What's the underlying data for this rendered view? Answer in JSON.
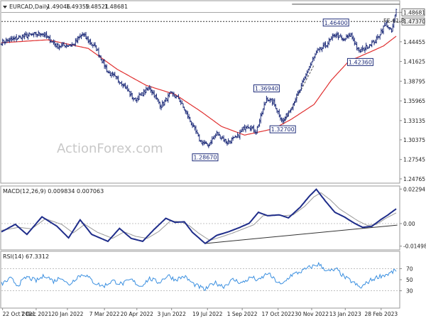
{
  "chart_data": [
    {
      "type": "line",
      "title": "EURCAD,Daily",
      "ohlc": {
        "open": "1.49046",
        "high": "1.49359",
        "low": "1.48521",
        "close": "1.48681"
      },
      "ylim": [
        1.2425,
        1.5025
      ],
      "y_ticks": [
        "1.48681",
        "1.47370",
        "1.44455",
        "1.41625",
        "1.38795",
        "1.35965",
        "1.33135",
        "1.30375",
        "1.27545",
        "1.24765"
      ],
      "y_tick_values": [
        1.48681,
        1.4737,
        1.44455,
        1.41625,
        1.38795,
        1.35965,
        1.33135,
        1.30375,
        1.27545,
        1.24765
      ],
      "highlighted_ticks": [
        "1.48681",
        "1.47370"
      ],
      "annotations": [
        {
          "label": "1.28670",
          "date_index": 176,
          "price": 1.2867
        },
        {
          "label": "1.36940",
          "date_index": 229,
          "price": 1.3694
        },
        {
          "label": "1.32700",
          "date_index": 243,
          "price": 1.327
        },
        {
          "label": "1.46400",
          "date_index": 289,
          "price": 1.464
        },
        {
          "label": "1.42360",
          "date_index": 310,
          "price": 1.4236
        }
      ],
      "fib_label": "FE 61.8",
      "fib_price": 1.4985,
      "resistance_price": 1.4737,
      "trendline": [
        {
          "date_index": 242,
          "price": 1.3215
        },
        {
          "date_index": 270,
          "price": 1.411
        }
      ],
      "watermark": "ActionForex.com",
      "series": [
        {
          "type": "ohlc",
          "color": "#1f2d7a",
          "anchors": [
            [
              0,
              1.4436
            ],
            [
              18,
              1.452
            ],
            [
              35,
              1.457
            ],
            [
              48,
              1.4385
            ],
            [
              62,
              1.4405
            ],
            [
              70,
              1.4555
            ],
            [
              82,
              1.4345
            ],
            [
              92,
              1.401
            ],
            [
              105,
              1.3845
            ],
            [
              115,
              1.3605
            ],
            [
              128,
              1.3785
            ],
            [
              138,
              1.352
            ],
            [
              146,
              1.37
            ],
            [
              153,
              1.3632
            ],
            [
              162,
              1.3345
            ],
            [
              172,
              1.3015
            ],
            [
              178,
              1.2955
            ],
            [
              186,
              1.3125
            ],
            [
              195,
              1.3005
            ],
            [
              203,
              1.3065
            ],
            [
              212,
              1.3255
            ],
            [
              220,
              1.3155
            ],
            [
              229,
              1.3635
            ],
            [
              235,
              1.3575
            ],
            [
              243,
              1.3295
            ],
            [
              250,
              1.3495
            ],
            [
              258,
              1.3755
            ],
            [
              265,
              1.4055
            ],
            [
              272,
              1.4285
            ],
            [
              280,
              1.4395
            ],
            [
              289,
              1.456
            ],
            [
              295,
              1.4465
            ],
            [
              302,
              1.4545
            ],
            [
              309,
              1.4295
            ],
            [
              316,
              1.4385
            ],
            [
              323,
              1.4455
            ],
            [
              332,
              1.4705
            ],
            [
              337,
              1.4585
            ],
            [
              341,
              1.4895
            ]
          ]
        },
        {
          "name": "",
          "type": "moving-average",
          "color": "#e03030",
          "anchors": [
            [
              0,
              1.4432
            ],
            [
              40,
              1.4473
            ],
            [
              75,
              1.435
            ],
            [
              100,
              1.405
            ],
            [
              125,
              1.382
            ],
            [
              150,
              1.369
            ],
            [
              172,
              1.3448
            ],
            [
              190,
              1.323
            ],
            [
              210,
              1.3105
            ],
            [
              235,
              1.3195
            ],
            [
              250,
              1.3328
            ],
            [
              270,
              1.3545
            ],
            [
              285,
              1.3895
            ],
            [
              300,
              1.4165
            ],
            [
              318,
              1.4295
            ],
            [
              330,
              1.4385
            ],
            [
              341,
              1.4525
            ]
          ]
        }
      ],
      "x_ticks": [
        {
          "label": "22 Oct 2021",
          "index": 1
        },
        {
          "label": "7 Dec 2021",
          "index": 30
        },
        {
          "label": "20 Jan 2022",
          "index": 57
        },
        {
          "label": "7 Mar 2022",
          "index": 89
        },
        {
          "label": "20 Apr 2022",
          "index": 117
        },
        {
          "label": "3 Jun 2022",
          "index": 147
        },
        {
          "label": "19 Jul 2022",
          "index": 178
        },
        {
          "label": "1 Sep 2022",
          "index": 208
        },
        {
          "label": "17 Oct 2022",
          "index": 239
        },
        {
          "label": "30 Nov 2022",
          "index": 268
        },
        {
          "label": "13 Jan 2023",
          "index": 297
        },
        {
          "label": "28 Feb 2023",
          "index": 328
        }
      ]
    },
    {
      "type": "line",
      "title": "MACD(12,26,9) 0.009834 0.007063",
      "ylim": [
        -0.017,
        0.0245
      ],
      "y_ticks": [
        "0.02294",
        "0.00",
        "-0.014989"
      ],
      "y_tick_values": [
        0.02294,
        0,
        -0.014989
      ],
      "trendline": [
        {
          "date_index": 176,
          "value": -0.0132
        },
        {
          "date_index": 342,
          "value": -0.001
        }
      ],
      "series": [
        {
          "name": "",
          "color": "#1f2d8a",
          "anchors": [
            [
              0,
              -0.0055
            ],
            [
              12,
              -0.0005
            ],
            [
              22,
              -0.0072
            ],
            [
              35,
              0.0045
            ],
            [
              48,
              -0.0018
            ],
            [
              58,
              -0.0095
            ],
            [
              68,
              0.0025
            ],
            [
              78,
              -0.0072
            ],
            [
              92,
              -0.0118
            ],
            [
              102,
              -0.0032
            ],
            [
              112,
              -0.0098
            ],
            [
              122,
              -0.0118
            ],
            [
              132,
              -0.0038
            ],
            [
              142,
              0.0035
            ],
            [
              150,
              0.0008
            ],
            [
              158,
              0.0012
            ],
            [
              165,
              -0.0058
            ],
            [
              176,
              -0.0132
            ],
            [
              186,
              -0.0078
            ],
            [
              196,
              -0.0055
            ],
            [
              206,
              -0.0025
            ],
            [
              214,
              0.0002
            ],
            [
              222,
              0.0075
            ],
            [
              230,
              0.0052
            ],
            [
              240,
              0.0058
            ],
            [
              248,
              0.0038
            ],
            [
              258,
              0.0108
            ],
            [
              266,
              0.0182
            ],
            [
              272,
              0.0228
            ],
            [
              280,
              0.0148
            ],
            [
              288,
              0.0075
            ],
            [
              296,
              0.0045
            ],
            [
              305,
              0.0002
            ],
            [
              312,
              -0.0025
            ],
            [
              320,
              -0.0018
            ],
            [
              328,
              0.0028
            ],
            [
              334,
              0.0058
            ],
            [
              341,
              0.0098
            ]
          ]
        },
        {
          "name": "",
          "color": "#999999",
          "anchors": [
            [
              0,
              -0.0045
            ],
            [
              15,
              -0.0025
            ],
            [
              26,
              -0.0035
            ],
            [
              38,
              0.0032
            ],
            [
              52,
              -0.0005
            ],
            [
              62,
              -0.0062
            ],
            [
              72,
              -0.0005
            ],
            [
              83,
              -0.0058
            ],
            [
              96,
              -0.0098
            ],
            [
              106,
              -0.0055
            ],
            [
              116,
              -0.0085
            ],
            [
              126,
              -0.0098
            ],
            [
              136,
              -0.0052
            ],
            [
              146,
              0.0018
            ],
            [
              155,
              0.0012
            ],
            [
              162,
              -0.0012
            ],
            [
              170,
              -0.0062
            ],
            [
              180,
              -0.0112
            ],
            [
              190,
              -0.0088
            ],
            [
              200,
              -0.0062
            ],
            [
              210,
              -0.0032
            ],
            [
              218,
              -0.0008
            ],
            [
              226,
              0.0052
            ],
            [
              235,
              0.0058
            ],
            [
              244,
              0.0052
            ],
            [
              252,
              0.0058
            ],
            [
              262,
              0.0115
            ],
            [
              270,
              0.0178
            ],
            [
              276,
              0.0205
            ],
            [
              284,
              0.0158
            ],
            [
              292,
              0.0098
            ],
            [
              300,
              0.0058
            ],
            [
              308,
              0.0018
            ],
            [
              316,
              -0.0012
            ],
            [
              324,
              -0.0005
            ],
            [
              332,
              0.0035
            ],
            [
              341,
              0.0071
            ]
          ]
        }
      ]
    },
    {
      "type": "line",
      "title": "RSI(14) 67.3312",
      "ylim": [
        0,
        100
      ],
      "y_ticks": [
        "70",
        "50",
        "30"
      ],
      "y_tick_values": [
        70,
        50,
        30
      ],
      "reference_levels": [
        30,
        70
      ],
      "series": [
        {
          "name": "",
          "color": "#3a8fe0",
          "anchors": [
            [
              0,
              42
            ],
            [
              8,
              52
            ],
            [
              14,
              40
            ],
            [
              22,
              55
            ],
            [
              30,
              48
            ],
            [
              38,
              58
            ],
            [
              45,
              47
            ],
            [
              52,
              55
            ],
            [
              58,
              40
            ],
            [
              66,
              56
            ],
            [
              72,
              60
            ],
            [
              80,
              45
            ],
            [
              88,
              38
            ],
            [
              96,
              48
            ],
            [
              104,
              42
            ],
            [
              112,
              50
            ],
            [
              120,
              38
            ],
            [
              128,
              52
            ],
            [
              136,
              45
            ],
            [
              144,
              58
            ],
            [
              150,
              50
            ],
            [
              158,
              56
            ],
            [
              166,
              42
            ],
            [
              176,
              32
            ],
            [
              184,
              45
            ],
            [
              192,
              38
            ],
            [
              200,
              50
            ],
            [
              208,
              44
            ],
            [
              216,
              55
            ],
            [
              222,
              48
            ],
            [
              230,
              62
            ],
            [
              236,
              50
            ],
            [
              242,
              40
            ],
            [
              250,
              58
            ],
            [
              258,
              64
            ],
            [
              266,
              72
            ],
            [
              274,
              78
            ],
            [
              282,
              65
            ],
            [
              290,
              68
            ],
            [
              296,
              55
            ],
            [
              304,
              45
            ],
            [
              310,
              35
            ],
            [
              318,
              48
            ],
            [
              326,
              56
            ],
            [
              334,
              60
            ],
            [
              341,
              67
            ]
          ]
        }
      ]
    }
  ]
}
